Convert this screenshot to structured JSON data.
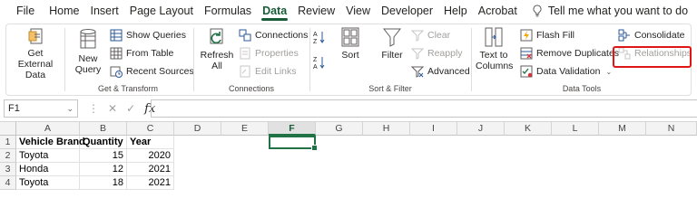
{
  "menu": {
    "items": [
      "File",
      "Home",
      "Insert",
      "Page Layout",
      "Formulas",
      "Data",
      "Review",
      "View",
      "Developer",
      "Help",
      "Acrobat"
    ],
    "active": "Data",
    "tell_me": "Tell me what you want to do"
  },
  "ribbon": {
    "get_transform": {
      "label": "Get & Transform",
      "get_external_data": "Get External Data",
      "new_query": "New Query",
      "show_queries": "Show Queries",
      "from_table": "From Table",
      "recent_sources": "Recent Sources"
    },
    "connections": {
      "label": "Connections",
      "refresh_all": "Refresh All",
      "connections": "Connections",
      "properties": "Properties",
      "edit_links": "Edit Links"
    },
    "sort_filter": {
      "label": "Sort & Filter",
      "sort": "Sort",
      "filter": "Filter",
      "clear": "Clear",
      "reapply": "Reapply",
      "advanced": "Advanced"
    },
    "data_tools": {
      "label": "Data Tools",
      "text_to_columns": "Text to Columns",
      "flash_fill": "Flash Fill",
      "remove_duplicates": "Remove Duplicates",
      "data_validation": "Data Validation",
      "consolidate": "Consolidate",
      "relationships": "Relationships"
    }
  },
  "formula_bar": {
    "name_box": "F1",
    "fx": "fx",
    "formula": ""
  },
  "sheet": {
    "columns": [
      "A",
      "B",
      "C",
      "D",
      "E",
      "F",
      "G",
      "H",
      "I",
      "J",
      "K",
      "L",
      "M",
      "N"
    ],
    "selected_column": "F",
    "rows": [
      "1",
      "2",
      "3",
      "4"
    ],
    "cells": {
      "A1": "Vehicle Brand",
      "B1": "Quantity",
      "C1": "Year",
      "A2": "Toyota",
      "B2": "15",
      "C2": "2020",
      "A3": "Honda",
      "B3": "12",
      "C3": "2021",
      "A4": "Toyota",
      "B4": "18",
      "C4": "2021"
    }
  },
  "colors": {
    "accent": "#185c37",
    "highlight_box": "#e01515",
    "active_cell": "#217346"
  }
}
